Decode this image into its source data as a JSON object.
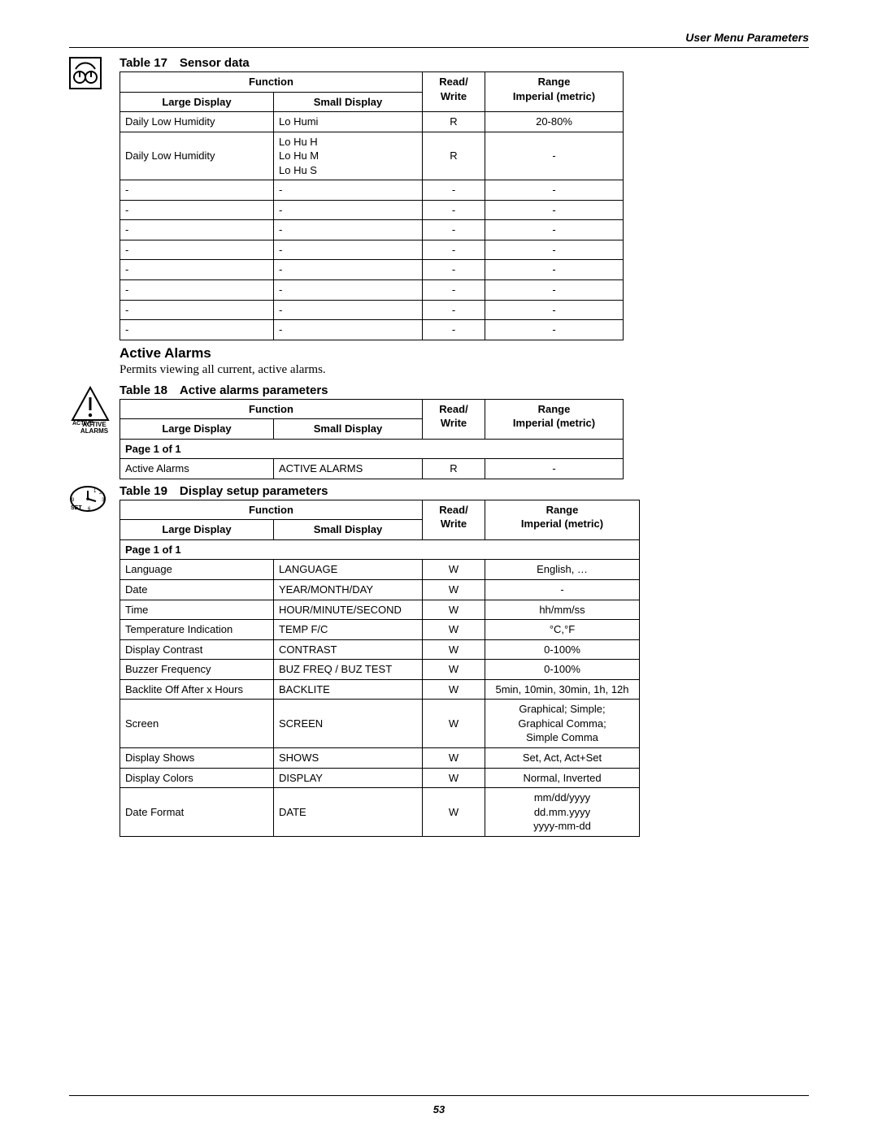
{
  "header_right": "User Menu Parameters",
  "page_number": "53",
  "common_headers": {
    "function": "Function",
    "large_display": "Large Display",
    "small_display": "Small Display",
    "read_write": "Read/\nWrite",
    "range": "Range\nImperial (metric)"
  },
  "table17": {
    "caption": "Table 17 Sensor data",
    "rows": [
      {
        "large": "Daily Low Humidity",
        "small": "Lo Humi",
        "rw": "R",
        "range": "20-80%"
      },
      {
        "large": "Daily Low Humidity",
        "small": "Lo Hu H\nLo Hu M\nLo Hu S",
        "rw": "R",
        "range": "-"
      },
      {
        "large": "-",
        "small": "-",
        "rw": "-",
        "range": "-"
      },
      {
        "large": "-",
        "small": "-",
        "rw": "-",
        "range": "-"
      },
      {
        "large": "-",
        "small": "-",
        "rw": "-",
        "range": "-"
      },
      {
        "large": "-",
        "small": "-",
        "rw": "-",
        "range": "-"
      },
      {
        "large": "-",
        "small": "-",
        "rw": "-",
        "range": "-"
      },
      {
        "large": "-",
        "small": "-",
        "rw": "-",
        "range": "-"
      },
      {
        "large": "-",
        "small": "-",
        "rw": "-",
        "range": "-"
      },
      {
        "large": "-",
        "small": "-",
        "rw": "-",
        "range": "-"
      }
    ]
  },
  "active_alarms_section": {
    "title": "Active Alarms",
    "desc": "Permits viewing all current, active alarms."
  },
  "table18": {
    "caption": "Table 18 Active alarms parameters",
    "page_row": "Page 1 of 1",
    "rows": [
      {
        "large": "Active Alarms",
        "small": "ACTIVE ALARMS",
        "rw": "R",
        "range": "-"
      }
    ]
  },
  "table19": {
    "caption": "Table 19 Display setup parameters",
    "page_row": "Page 1 of 1",
    "rows": [
      {
        "large": "Language",
        "small": "LANGUAGE",
        "rw": "W",
        "range": "English, …"
      },
      {
        "large": "Date",
        "small": "YEAR/MONTH/DAY",
        "rw": "W",
        "range": "-"
      },
      {
        "large": "Time",
        "small": "HOUR/MINUTE/SECOND",
        "rw": "W",
        "range": "hh/mm/ss"
      },
      {
        "large": "Temperature Indication",
        "small": "TEMP F/C",
        "rw": "W",
        "range": "°C,°F"
      },
      {
        "large": "Display Contrast",
        "small": "CONTRAST",
        "rw": "W",
        "range": "0-100%"
      },
      {
        "large": "Buzzer Frequency",
        "small": "BUZ FREQ / BUZ TEST",
        "rw": "W",
        "range": "0-100%"
      },
      {
        "large": "Backlite Off After x Hours",
        "small": "BACKLITE",
        "rw": "W",
        "range": "5min, 10min, 30min, 1h, 12h"
      },
      {
        "large": "Screen",
        "small": "SCREEN",
        "rw": "W",
        "range": "Graphical; Simple;\nGraphical Comma;\nSimple Comma"
      },
      {
        "large": "Display Shows",
        "small": "SHOWS",
        "rw": "W",
        "range": "Set, Act, Act+Set"
      },
      {
        "large": "Display Colors",
        "small": "DISPLAY",
        "rw": "W",
        "range": "Normal, Inverted"
      },
      {
        "large": "Date Format",
        "small": "DATE",
        "rw": "W",
        "range": "mm/dd/yyyy\ndd.mm.yyyy\nyyyy-mm-dd"
      }
    ]
  }
}
